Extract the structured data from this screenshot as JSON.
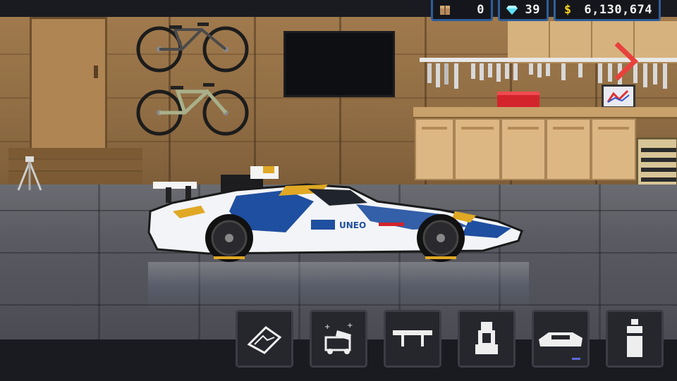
{
  "hud": {
    "crates": {
      "icon": "crate-icon",
      "value": "0"
    },
    "diamonds": {
      "icon": "diamond-icon",
      "value": "39"
    },
    "money": {
      "icon": "dollar-icon",
      "value": "6,130,674"
    }
  },
  "navigation": {
    "next_icon": "chevron-right-icon"
  },
  "car_decals": {
    "sponsor_text": "UNEO"
  },
  "menu": {
    "buttons": [
      {
        "icon": "track-map-icon"
      },
      {
        "icon": "car-wash-icon"
      },
      {
        "icon": "spoiler-icon"
      },
      {
        "icon": "seat-icon"
      },
      {
        "icon": "car-body-icon"
      },
      {
        "icon": "spray-paint-icon"
      }
    ]
  },
  "colors": {
    "hud_border": "#2f5e9a",
    "arrow": "#e8413d",
    "wall": "#8f6c43",
    "floor": "#5a5b62",
    "car_white": "#f2f4f7",
    "car_blue": "#1f4fa0",
    "car_gold": "#e0a824"
  }
}
